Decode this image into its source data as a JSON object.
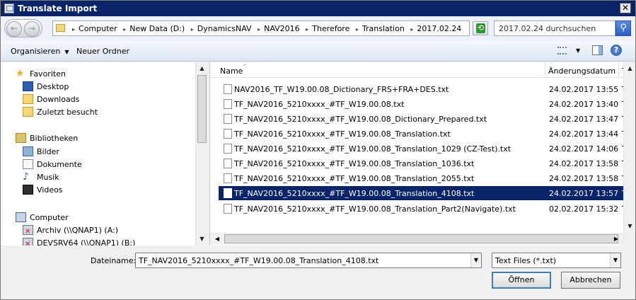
{
  "window": {
    "title": "Translate Import",
    "close_glyph": "✕"
  },
  "address": {
    "crumbs": [
      "Computer",
      "New Data (D:)",
      "DynamicsNAV",
      "NAV2016",
      "Therefore",
      "Translation",
      "2017.02.24"
    ],
    "search_placeholder": "2017.02.24 durchsuchen"
  },
  "toolbar": {
    "organize": "Organisieren",
    "new_folder": "Neuer Ordner"
  },
  "nav": {
    "favorites": {
      "label": "Favoriten",
      "items": [
        "Desktop",
        "Downloads",
        "Zuletzt besucht"
      ]
    },
    "libraries": {
      "label": "Bibliotheken",
      "items": [
        "Bilder",
        "Dokumente",
        "Musik",
        "Videos"
      ]
    },
    "computer": {
      "label": "Computer",
      "items": [
        "Archiv (\\\\QNAP1) (A:)",
        "DEVSRV64 (\\\\QNAP1) (B:)"
      ]
    }
  },
  "columns": {
    "name": "Name",
    "date": "Änderungsdatum",
    "type": "Typ"
  },
  "files": [
    {
      "name": "NAV2016_TF_W19.00.08_Dictionary_FRS+FRA+DES.txt",
      "date": "24.02.2017 13:55",
      "type": "TXT"
    },
    {
      "name": "TF_NAV2016_5210xxxx_#TF_W19.00.08.txt",
      "date": "24.02.2017 13:40",
      "type": "TXT"
    },
    {
      "name": "TF_NAV2016_5210xxxx_#TF_W19.00.08_Dictionary_Prepared.txt",
      "date": "24.02.2017 13:47",
      "type": "TXT"
    },
    {
      "name": "TF_NAV2016_5210xxxx_#TF_W19.00.08_Translation.txt",
      "date": "24.02.2017 13:44",
      "type": "TXT"
    },
    {
      "name": "TF_NAV2016_5210xxxx_#TF_W19.00.08_Translation_1029 (CZ-Test).txt",
      "date": "24.02.2017 14:06",
      "type": "TXT"
    },
    {
      "name": "TF_NAV2016_5210xxxx_#TF_W19.00.08_Translation_1036.txt",
      "date": "24.02.2017 13:58",
      "type": "TXT"
    },
    {
      "name": "TF_NAV2016_5210xxxx_#TF_W19.00.08_Translation_2055.txt",
      "date": "24.02.2017 13:58",
      "type": "TXT"
    },
    {
      "name": "TF_NAV2016_5210xxxx_#TF_W19.00.08_Translation_4108.txt",
      "date": "24.02.2017 13:57",
      "type": "TXT",
      "selected": true
    },
    {
      "name": "TF_NAV2016_5210xxxx_#TF_W19.00.08_Translation_Part2(Navigate).txt",
      "date": "02.02.2017 15:32",
      "type": "TXT"
    }
  ],
  "bottom": {
    "filename_label": "Dateiname:",
    "filename_value": "TF_NAV2016_5210xxxx_#TF_W19.00.08_Translation_4108.txt",
    "filetype_value": "Text Files (*.txt)",
    "open_button": "Öffnen",
    "cancel_button": "Abbrechen"
  },
  "colors": {
    "selection": "#0a246a",
    "titlebar": "#0a246a"
  },
  "icons": {
    "back": "←",
    "forward": "→",
    "caret_down": "▼",
    "caret_right": "▸",
    "caret_up": "▲",
    "caret_left": "◀",
    "caret_right_solid": "▶",
    "help": "?",
    "search": "⚲",
    "star": "★",
    "music": "♪",
    "sort": "^"
  }
}
